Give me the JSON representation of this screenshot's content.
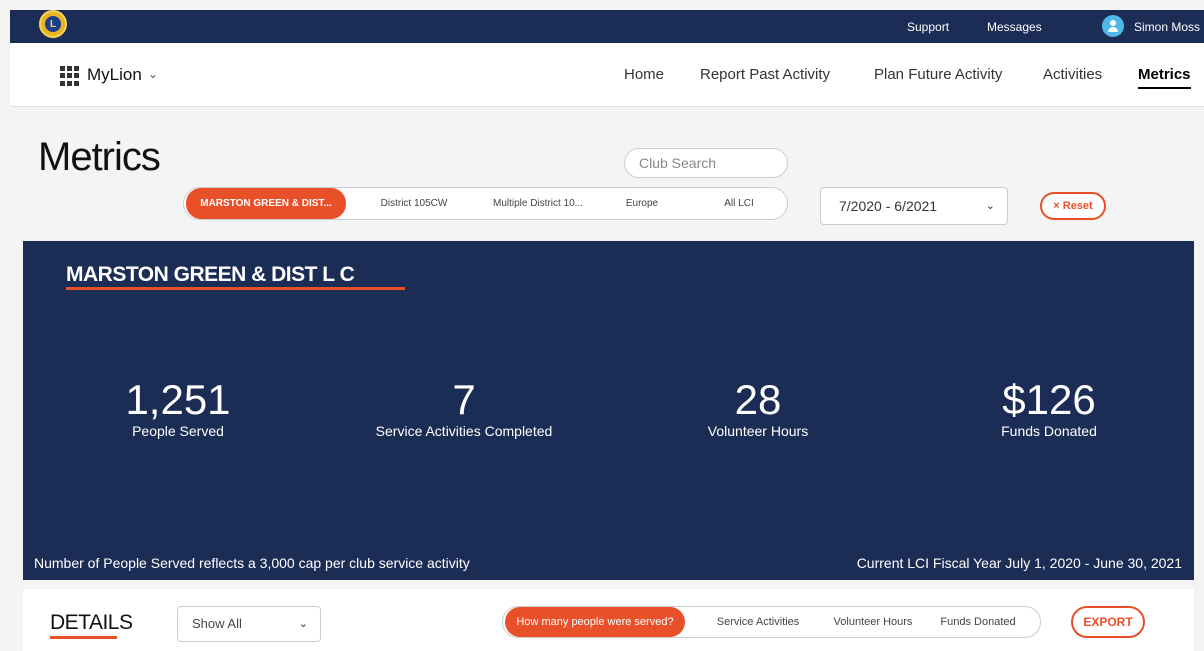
{
  "topbar": {
    "logo_text": "L",
    "support": "Support",
    "messages": "Messages",
    "user_name": "Simon Moss"
  },
  "nav": {
    "brand": "MyLion",
    "brand_chevron": "⌄",
    "items": [
      "Home",
      "Report Past Activity",
      "Plan Future Activity",
      "Activities",
      "Metrics"
    ],
    "active": "Metrics"
  },
  "page": {
    "title": "Metrics",
    "club_search_placeholder": "Club Search",
    "scope_tabs": [
      "MARSTON GREEN & DIST...",
      "District 105CW",
      "Multiple District 10...",
      "Europe",
      "All LCI"
    ],
    "scope_active": "MARSTON GREEN & DIST...",
    "fiscal_period": "7/2020 - 6/2021",
    "reset_label": "× Reset"
  },
  "panel": {
    "club_name": "MARSTON GREEN & DIST L C",
    "stats": [
      {
        "value": "1,251",
        "label": "People Served"
      },
      {
        "value": "7",
        "label": "Service Activities Completed"
      },
      {
        "value": "28",
        "label": "Volunteer Hours"
      },
      {
        "value": "$126",
        "label": "Funds Donated"
      }
    ],
    "footnote_left": "Number of People Served reflects a 3,000 cap per club service activity",
    "footnote_right": "Current LCI Fiscal Year July 1, 2020 - June 30, 2021"
  },
  "details": {
    "title": "DETAILS",
    "filter_value": "Show All",
    "tabs": [
      "How many people were served?",
      "Service Activities",
      "Volunteer Hours",
      "Funds Donated"
    ],
    "tab_active": "How many people were served?",
    "export_label": "EXPORT"
  },
  "colors": {
    "navy": "#1b2d55",
    "accent": "#e8502a"
  }
}
